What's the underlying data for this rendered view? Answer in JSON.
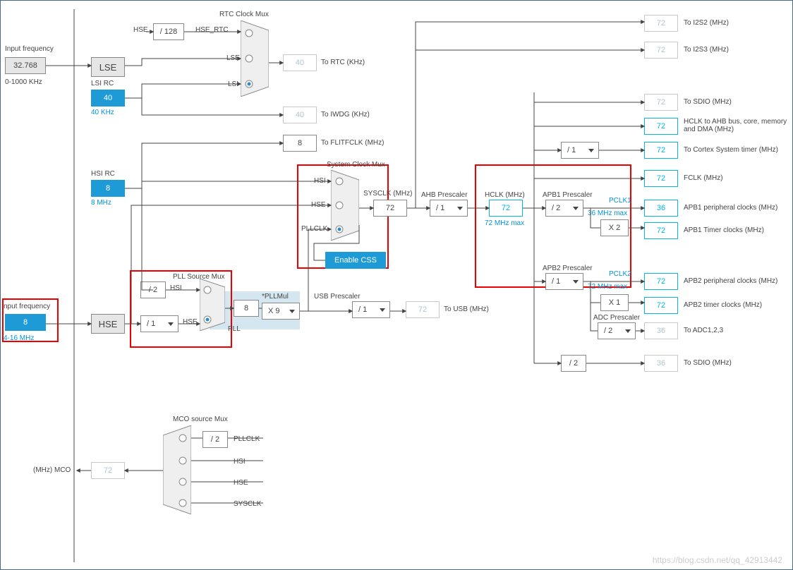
{
  "inputs": {
    "lse_freq_label": "Input frequency",
    "lse_freq_value": "32.768",
    "lse_freq_range": "0-1000 KHz",
    "hse_freq_label": "nput frequency",
    "hse_freq_value": "8",
    "hse_freq_range": "4-16 MHz"
  },
  "osc": {
    "lse_label": "LSE",
    "lsi_rc_label": "LSI RC",
    "lsi_rc_value": "40",
    "lsi_rc_unit": "40 KHz",
    "hsi_rc_label": "HSI RC",
    "hsi_rc_value": "8",
    "hsi_rc_unit": "8 MHz",
    "hse_label": "HSE"
  },
  "rtc": {
    "title": "RTC Clock Mux",
    "hse_label": "HSE",
    "div128": "/ 128",
    "hse_rtc": "HSE_RTC",
    "lse": "LSE",
    "lsi": "LSI",
    "rtc_value": "40",
    "rtc_unit": "To RTC (KHz)",
    "iwdg_value": "40",
    "iwdg_unit": "To IWDG (KHz)"
  },
  "pll": {
    "title": "PLL Source Mux",
    "hsi_div": "/ 2",
    "hsi": "HSI",
    "hse_div": "/ 1",
    "hse": "HSE",
    "pll_label": "PLL",
    "pll_in": "8",
    "pllmul_label": "*PLLMul",
    "pllmul_value": "X 9"
  },
  "usb": {
    "title": "USB Prescaler",
    "div": "/ 1",
    "value": "72",
    "unit": "To USB (MHz)"
  },
  "flitf": {
    "value": "8",
    "unit": "To FLITFCLK (MHz)"
  },
  "sysclk": {
    "title": "System Clock Mux",
    "hsi": "HSI",
    "hse": "HSE",
    "pllclk": "PLLCLK",
    "css_btn": "Enable CSS",
    "label": "SYSCLK (MHz)",
    "value": "72"
  },
  "ahb": {
    "title": "AHB Prescaler",
    "div": "/ 1",
    "hclk_label": "HCLK (MHz)",
    "hclk_value": "72",
    "hclk_max": "72 MHz max"
  },
  "apb1": {
    "title": "APB1 Prescaler",
    "div": "/ 2",
    "pclk1": "PCLK1",
    "max": "36 MHz max",
    "x2": "X 2"
  },
  "apb2": {
    "title": "APB2 Prescaler",
    "div": "/ 1",
    "pclk2": "PCLK2",
    "max": "72 MHz max",
    "x1": "X 1"
  },
  "adc": {
    "title": "ADC Prescaler",
    "div": "/ 2"
  },
  "outputs": {
    "i2s2": {
      "v": "72",
      "u": "To I2S2 (MHz)"
    },
    "i2s3": {
      "v": "72",
      "u": "To I2S3 (MHz)"
    },
    "sdio": {
      "v": "72",
      "u": "To SDIO (MHz)"
    },
    "ahb": {
      "v": "72",
      "u": "HCLK to AHB bus, core, memory and DMA (MHz)"
    },
    "cortex": {
      "v": "72",
      "u": "To Cortex System timer (MHz)",
      "div": "/ 1"
    },
    "fclk": {
      "v": "72",
      "u": "FCLK (MHz)"
    },
    "apb1p": {
      "v": "36",
      "u": "APB1 peripheral clocks (MHz)"
    },
    "apb1t": {
      "v": "72",
      "u": "APB1 Timer clocks (MHz)"
    },
    "apb2p": {
      "v": "72",
      "u": "APB2 peripheral clocks (MHz)"
    },
    "apb2t": {
      "v": "72",
      "u": "APB2 timer clocks (MHz)"
    },
    "adc": {
      "v": "36",
      "u": "To ADC1,2,3"
    },
    "sdio2": {
      "v": "36",
      "u": "To SDIO (MHz)",
      "div": "/ 2"
    }
  },
  "mco": {
    "title": "MCO source Mux",
    "label": "(MHz) MCO",
    "value": "72",
    "div2": "/ 2",
    "pllclk": "PLLCLK",
    "hsi": "HSI",
    "hse": "HSE",
    "sysclk": "SYSCLK"
  },
  "watermark": "https://blog.csdn.net/qq_42913442"
}
